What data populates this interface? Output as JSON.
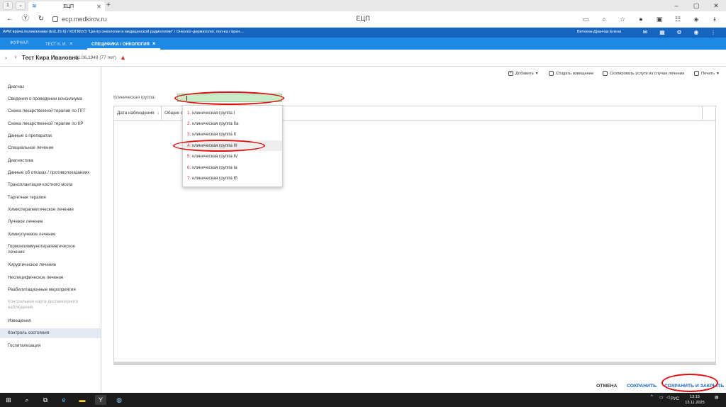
{
  "browser": {
    "tab_counter": "1",
    "tab_title": "ЕЦП",
    "url": "ecp.medkirov.ru",
    "page_title": "ЕЦП"
  },
  "app_header": {
    "arm_text": "АРМ врача поликлиники (Ext.JS 6) / КОГКБУЗ \"Центр онкологии и медицинской радиологии\" / Онколог-дерматолог. пол-ка / врач…",
    "user": "Веткина-Дранчак Елена"
  },
  "subtabs": [
    {
      "label": "ЖУРНАЛ"
    },
    {
      "label": "ТЕСТ К. И."
    },
    {
      "label": "СПЕЦИФИКА / ОНКОЛОГИЯ"
    }
  ],
  "patient": {
    "name": "Тест Кира Ивановна",
    "dob": "01.06.1948 (77 лет)"
  },
  "sidebar": [
    {
      "label": "Диагноз"
    },
    {
      "label": "Сведения о проведении консилиума"
    },
    {
      "label": "Схема лекарственной терапии по ПГГ"
    },
    {
      "label": "Схема лекарственной терапии по КР"
    },
    {
      "label": "Данные о препаратах"
    },
    {
      "label": "Специальное лечение"
    },
    {
      "label": "Диагностика"
    },
    {
      "label": "Данные об отказах / противопоказаниях"
    },
    {
      "label": "Трансплантация костного мозга"
    },
    {
      "label": "Таргетная терапия"
    },
    {
      "label": "Химиотерапевтическое лечение"
    },
    {
      "label": "Лучевое лечение"
    },
    {
      "label": "Химиолучевое лечение"
    },
    {
      "label": "Гормоноиммунотерапевтическое лечение"
    },
    {
      "label": "Хирургическое лечение"
    },
    {
      "label": "Неспецифическое лечение"
    },
    {
      "label": "Реабилитационные мероприятия"
    },
    {
      "label": "Контрольная карта диспансерного наблюдения"
    },
    {
      "label": "Извещения"
    },
    {
      "label": "Контроль состояния"
    },
    {
      "label": "Госпитализация"
    }
  ],
  "toolbar": {
    "add": "Добавить",
    "create_notice": "Создать извещение",
    "copy_services": "Скопировать услуги из случая лечения",
    "print": "Печать"
  },
  "form": {
    "clinical_group_label": "Клиническая группа:"
  },
  "grid": {
    "columns": [
      "Дата наблюдения",
      "Общее со"
    ]
  },
  "dropdown": [
    {
      "num": "1.",
      "text": "клиническая группа I"
    },
    {
      "num": "2.",
      "text": "клиническая группа IIа"
    },
    {
      "num": "3.",
      "text": "клиническая группа II"
    },
    {
      "num": "4.",
      "text": "клиническая группа III"
    },
    {
      "num": "5.",
      "text": "клиническая группа IV"
    },
    {
      "num": "6.",
      "text": "клиническая группа Iа"
    },
    {
      "num": "7.",
      "text": "клиническая группа Iб"
    }
  ],
  "actions": {
    "cancel": "ОТМЕНА",
    "save": "СОХРАНИТЬ",
    "save_close": "СОХРАНИТЬ И ЗАКРЫТЬ"
  },
  "taskbar": {
    "lang": "РУС",
    "time": "13:15",
    "date": "13.11.2025"
  },
  "colors": {
    "app_blue": "#1565c0",
    "subtab_blue": "#1e88e5",
    "annotation_red": "#e01010",
    "input_green": "#c8ecc8"
  }
}
